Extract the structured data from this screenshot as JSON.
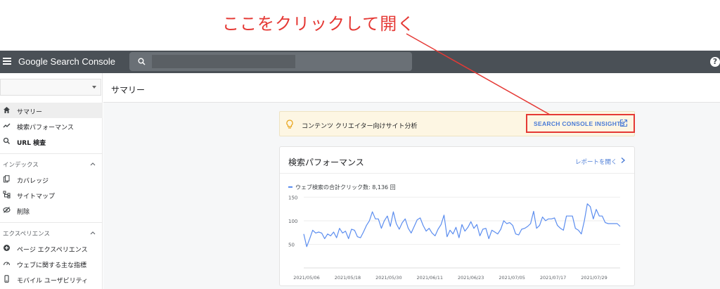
{
  "annotation": {
    "callout": "ここをクリックして開く"
  },
  "appbar": {
    "title": "Google Search Console"
  },
  "sidebar": {
    "items_top": [
      {
        "label": "サマリー",
        "icon": "home-icon",
        "active": true,
        "bold": false
      },
      {
        "label": "検索パフォーマンス",
        "icon": "trending-icon",
        "active": false,
        "bold": false
      },
      {
        "label": "URL 検査",
        "icon": "search-icon",
        "active": false,
        "bold": true
      }
    ],
    "index_section": {
      "title": "インデックス",
      "items": [
        {
          "label": "カバレッジ",
          "icon": "file-copy-icon"
        },
        {
          "label": "サイトマップ",
          "icon": "sitemap-icon"
        },
        {
          "label": "削除",
          "icon": "hidden-eye-icon"
        }
      ]
    },
    "experience_section": {
      "title": "エクスペリエンス",
      "items": [
        {
          "label": "ページ エクスペリエンス",
          "icon": "plus-circle-icon"
        },
        {
          "label": "ウェブに関する主な指標",
          "icon": "gauge-icon"
        },
        {
          "label": "モバイル ユーザビリティ",
          "icon": "phone-icon"
        }
      ]
    }
  },
  "page": {
    "title": "サマリー"
  },
  "insights": {
    "label": "コンテンツ クリエイター向けサイト分析",
    "link": "SEARCH CONSOLE INSIGHTS"
  },
  "performance": {
    "title": "検索パフォーマンス",
    "report_link": "レポートを開く"
  },
  "chart_data": {
    "type": "line",
    "series": [
      {
        "name": "ウェブ検索の合計クリック数: 8,136 回",
        "color": "#5b8def",
        "values": [
          72,
          45,
          62,
          80,
          74,
          76,
          74,
          62,
          72,
          68,
          76,
          64,
          84,
          74,
          78,
          62,
          82,
          80,
          66,
          64,
          76,
          90,
          100,
          119,
          104,
          104,
          84,
          100,
          110,
          88,
          119,
          94,
          82,
          96,
          104,
          84,
          74,
          88,
          102,
          106,
          90,
          78,
          84,
          74,
          68,
          82,
          92,
          112,
          66,
          80,
          72,
          86,
          64,
          92,
          78,
          86,
          98,
          84,
          92,
          68,
          82,
          84,
          62,
          80,
          76,
          72,
          82,
          100,
          94,
          96,
          90,
          72,
          70,
          82,
          84,
          88,
          94,
          120,
          84,
          90,
          108,
          100,
          104,
          104,
          106,
          90,
          84,
          80,
          110,
          110,
          110,
          84,
          80,
          72,
          100,
          136,
          130,
          104,
          124,
          110,
          110,
          96,
          94,
          94,
          94,
          94,
          88
        ]
      }
    ],
    "x_ticks": [
      "2021/05/06",
      "2021/05/18",
      "2021/05/30",
      "2021/06/11",
      "2021/06/23",
      "2021/07/05",
      "2021/07/17",
      "2021/07/29"
    ],
    "y_ticks": [
      "150",
      "100",
      "50"
    ],
    "ylim": [
      0,
      170
    ]
  }
}
